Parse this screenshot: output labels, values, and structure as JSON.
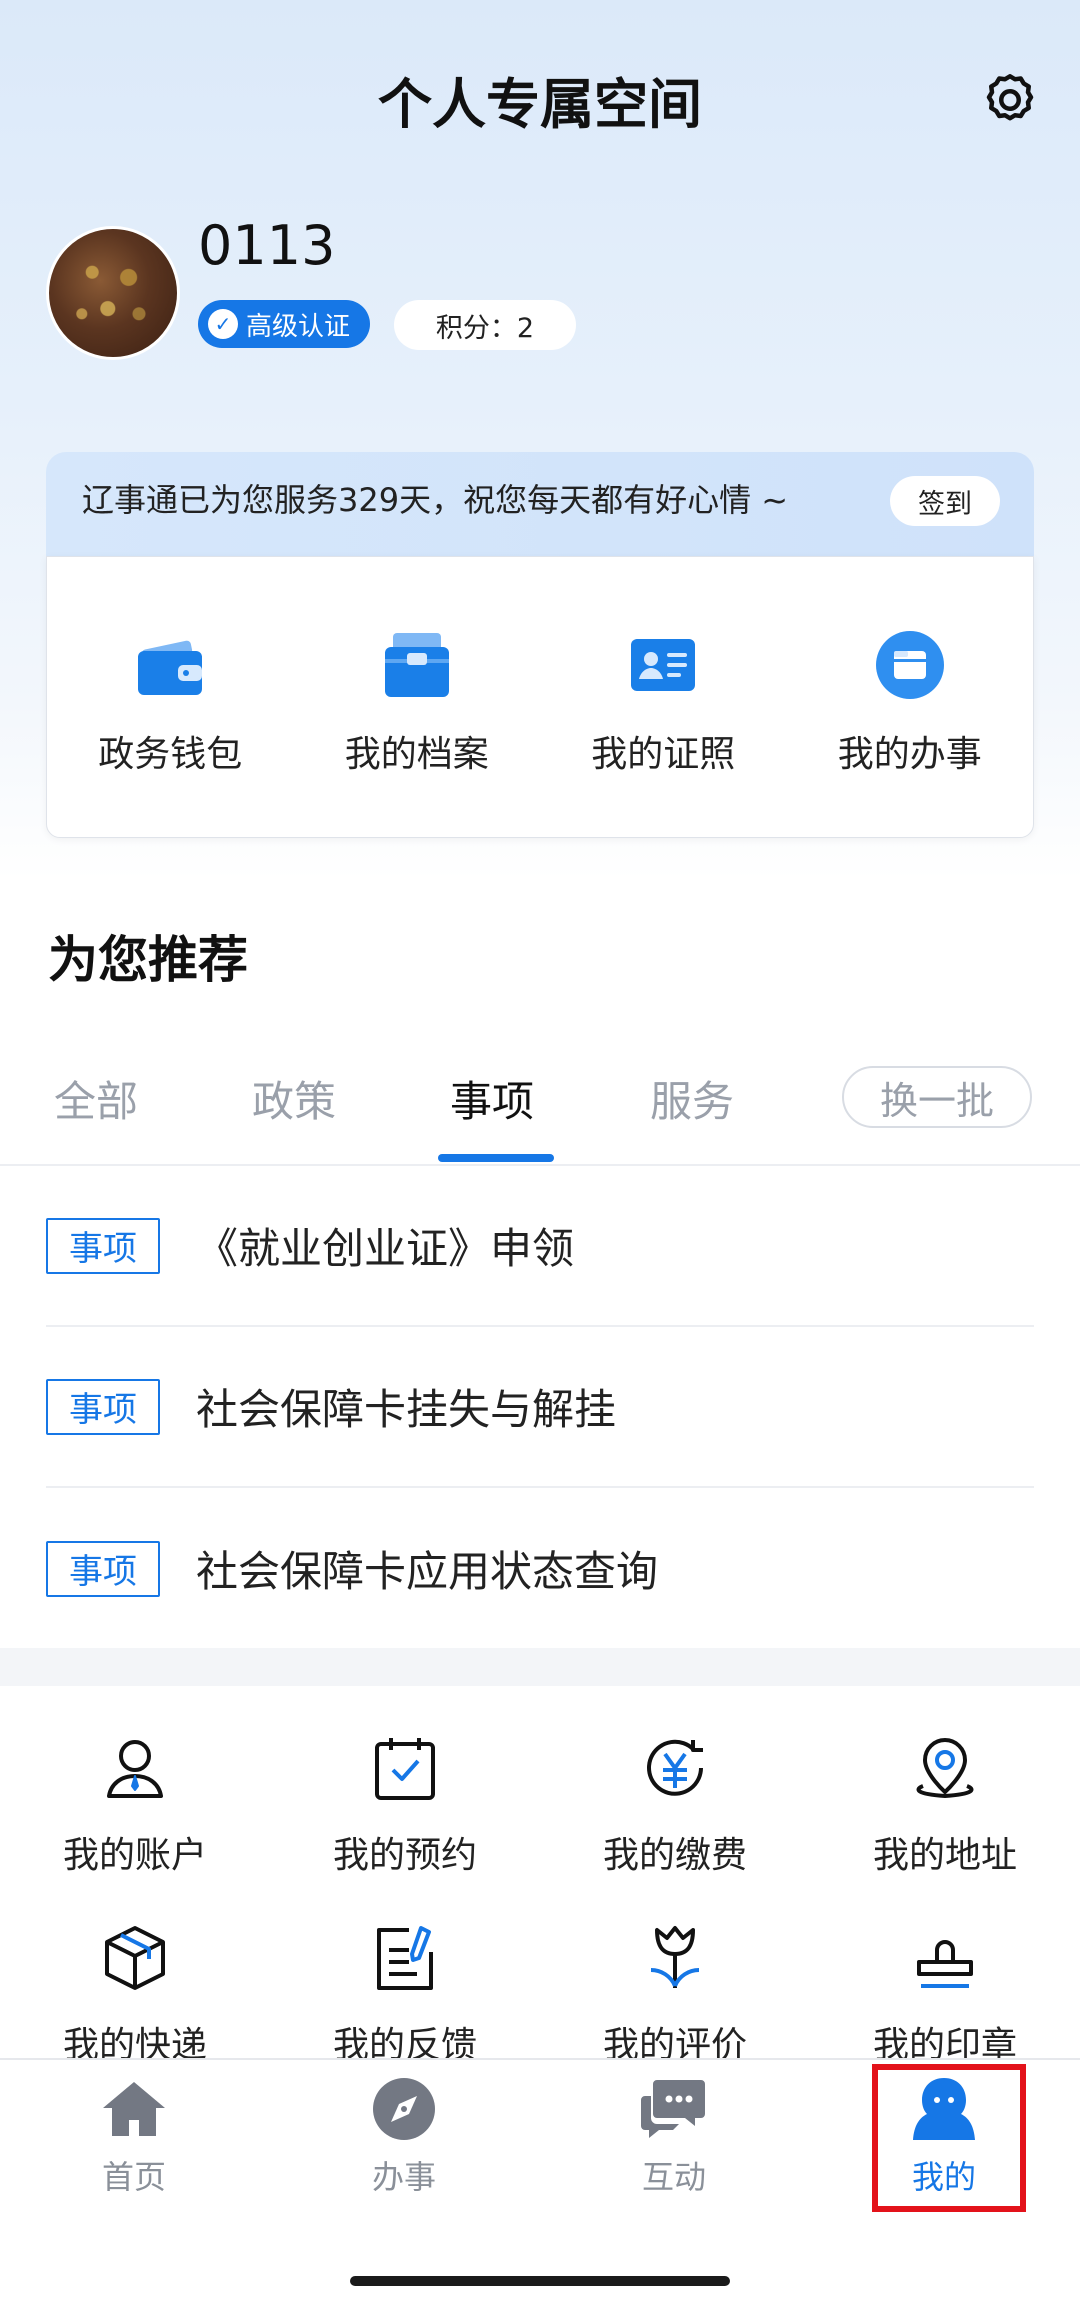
{
  "header": {
    "title": "个人专属空间",
    "settings_icon": "gear-icon"
  },
  "profile": {
    "username": "0113",
    "certification": "高级认证",
    "points": "积分：2"
  },
  "service_banner": {
    "text": "辽事通已为您服务329天，祝您每天都有好心情 ~",
    "checkin_label": "签到"
  },
  "quick_actions": [
    {
      "label": "政务钱包",
      "icon": "wallet-icon"
    },
    {
      "label": "我的档案",
      "icon": "briefcase-icon"
    },
    {
      "label": "我的证照",
      "icon": "id-card-icon"
    },
    {
      "label": "我的办事",
      "icon": "folder-icon"
    }
  ],
  "recommend": {
    "title": "为您推荐",
    "tabs": [
      "全部",
      "政策",
      "事项",
      "服务"
    ],
    "active_tab": "事项",
    "refresh_label": "换一批",
    "items": [
      {
        "tag": "事项",
        "text": "《就业创业证》申领"
      },
      {
        "tag": "事项",
        "text": "社会保障卡挂失与解挂"
      },
      {
        "tag": "事项",
        "text": "社会保障卡应用状态查询"
      }
    ]
  },
  "services": [
    {
      "label": "我的账户",
      "icon": "user-icon"
    },
    {
      "label": "我的预约",
      "icon": "calendar-check-icon"
    },
    {
      "label": "我的缴费",
      "icon": "yuan-icon"
    },
    {
      "label": "我的地址",
      "icon": "location-pin-icon"
    },
    {
      "label": "我的快递",
      "icon": "package-icon"
    },
    {
      "label": "我的反馈",
      "icon": "feedback-icon"
    },
    {
      "label": "我的评价",
      "icon": "tulip-icon"
    },
    {
      "label": "我的印章",
      "icon": "stamp-icon"
    }
  ],
  "bottom_nav": [
    {
      "label": "首页",
      "icon": "home-icon"
    },
    {
      "label": "办事",
      "icon": "compass-icon"
    },
    {
      "label": "互动",
      "icon": "chat-icon"
    },
    {
      "label": "我的",
      "icon": "person-icon"
    }
  ],
  "bottom_nav_active": "我的",
  "colors": {
    "accent": "#1677e6",
    "highlight": "#e3121a"
  }
}
